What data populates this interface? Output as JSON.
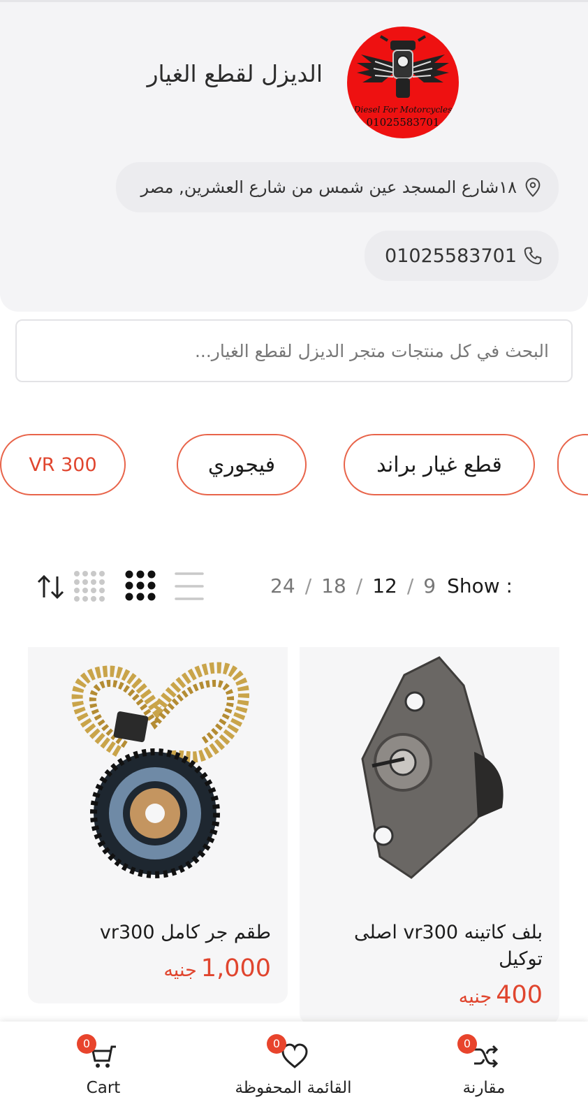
{
  "store": {
    "title": "الديزل لقطع الغيار",
    "logo_line1": "Diesel For Motorcycles",
    "logo_line2": "01025583701",
    "address": "١٨شارع المسجد عين شمس من شارع العشرين, مصر",
    "phone": "01025583701"
  },
  "search": {
    "placeholder": "البحث في كل منتجات متجر الديزل لقطع الغيار..."
  },
  "categories": [
    {
      "label": "VR 300"
    },
    {
      "label": "فيجوري"
    },
    {
      "label": "قطع غيار براند"
    }
  ],
  "toolbar": {
    "show_label": "Show :",
    "per_page_options": [
      "9",
      "12",
      "18",
      "24"
    ],
    "per_page_selected": "12",
    "view_icons": [
      "list-view-icon",
      "grid-3-icon",
      "grid-4-icon",
      "sort-icon"
    ]
  },
  "products": [
    {
      "name": "بلف كاتينه vr300 اصلى توكيل",
      "price": "400",
      "currency": "جنيه"
    },
    {
      "name": "طقم جر كامل vr300",
      "price": "1,000",
      "currency": "جنيه"
    }
  ],
  "bottom_nav": {
    "compare_label": "مقارنة",
    "compare_count": "0",
    "wishlist_label": "القائمة المحفوظة",
    "wishlist_count": "0",
    "cart_label": "Cart",
    "cart_count": "0"
  },
  "colors": {
    "accent": "#e0452e",
    "logo_red": "#ee1111",
    "header_bg": "#f4f4f6"
  }
}
